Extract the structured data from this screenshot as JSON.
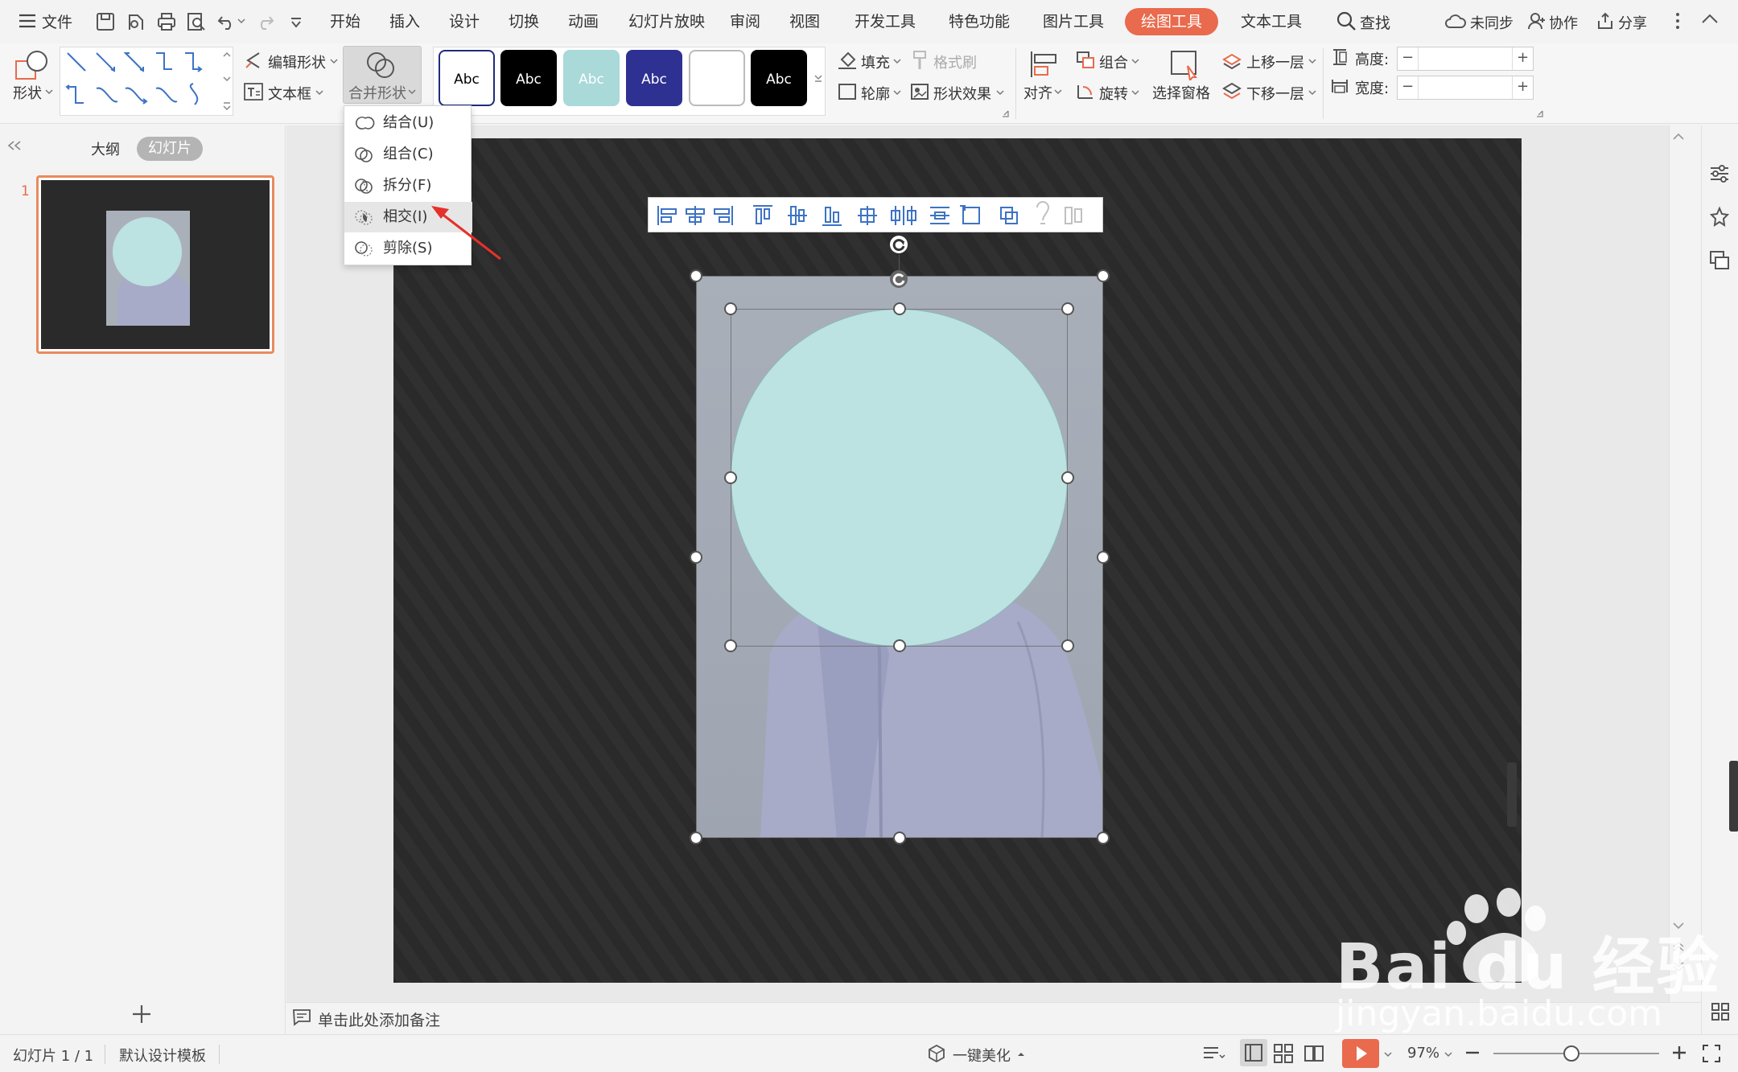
{
  "menubar": {
    "file": "文件",
    "tabs": [
      "开始",
      "插入",
      "设计",
      "切换",
      "动画",
      "幻灯片放映",
      "审阅",
      "视图",
      "开发工具",
      "特色功能",
      "图片工具",
      "绘图工具",
      "文本工具"
    ],
    "active_tab": "绘图工具",
    "search": "查找",
    "sync": "未同步",
    "collab": "协作",
    "share": "分享"
  },
  "ribbon": {
    "shape": "形状",
    "edit_shape": "编辑形状",
    "textbox": "文本框",
    "merge_shape": "合并形状",
    "style_samples": [
      {
        "text": "Abc",
        "bg": "#ffffff",
        "fg": "#000000",
        "border": "#1f2c7c"
      },
      {
        "text": "Abc",
        "bg": "#000000",
        "fg": "#ffffff",
        "border": "#000000"
      },
      {
        "text": "Abc",
        "bg": "#a9d9d9",
        "fg": "#ffffff",
        "border": "#a9d9d9"
      },
      {
        "text": "Abc",
        "bg": "#2e3192",
        "fg": "#ffffff",
        "border": "#2e3192"
      },
      {
        "text": "",
        "bg": "#ffffff",
        "fg": "#000000",
        "border": "#bbbbbb"
      },
      {
        "text": "Abc",
        "bg": "#000000",
        "fg": "#ffffff",
        "border": "#000000"
      }
    ],
    "fill": "填充",
    "format_painter": "格式刷",
    "outline": "轮廓",
    "shape_effect": "形状效果",
    "align": "对齐",
    "group": "组合",
    "rotate": "旋转",
    "selection_pane": "选择窗格",
    "bring_forward": "上移一层",
    "send_backward": "下移一层",
    "height_label": "高度:",
    "width_label": "宽度:"
  },
  "dropdown": {
    "items": [
      {
        "label": "结合(U)"
      },
      {
        "label": "组合(C)"
      },
      {
        "label": "拆分(F)"
      },
      {
        "label": "相交(I)"
      },
      {
        "label": "剪除(S)"
      }
    ],
    "highlighted": "相交(I)"
  },
  "leftpane": {
    "tab_outline": "大纲",
    "tab_slides": "幻灯片",
    "slide_number": "1"
  },
  "notes_placeholder": "单击此处添加备注",
  "statusbar": {
    "slide_info": "幻灯片 1 / 1",
    "template": "默认设计模板",
    "beautify": "一键美化",
    "zoom": "97%"
  },
  "watermark": {
    "brand": "Bai du 经验",
    "url": "jingyan.baidu.com"
  },
  "colors": {
    "accent": "#e96a4d",
    "circle_fill": "#bce2e2",
    "slide_bg": "#2a2a2a",
    "photo_bg": "#aab0ba",
    "blouse": "#a7abc8"
  }
}
